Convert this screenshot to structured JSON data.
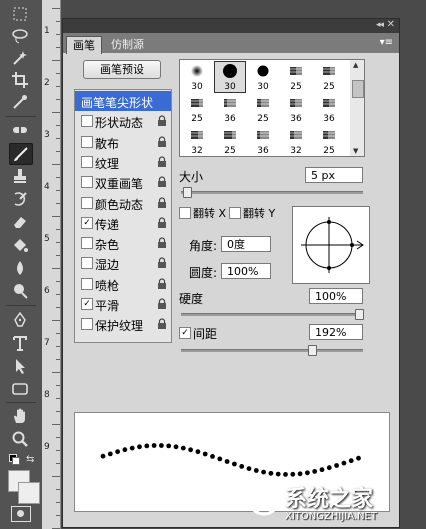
{
  "ruler": {
    "numbers": [
      "1",
      "2",
      "3",
      "4",
      "5",
      "6",
      "7",
      "8",
      "9"
    ]
  },
  "panel": {
    "collapse_glyph": "◂◂",
    "close_glyph": "✕",
    "menu_glyph": "▾≡",
    "tabs": [
      {
        "label": "画笔",
        "active": true
      },
      {
        "label": "仿制源",
        "active": false
      }
    ]
  },
  "brush": {
    "presets_button": "画笔预设",
    "options": [
      {
        "label": "画笔笔尖形状",
        "checked": null,
        "selected": true,
        "locked": false
      },
      {
        "label": "形状动态",
        "checked": false,
        "selected": false,
        "locked": true
      },
      {
        "label": "散布",
        "checked": false,
        "selected": false,
        "locked": true
      },
      {
        "label": "纹理",
        "checked": false,
        "selected": false,
        "locked": true
      },
      {
        "label": "双重画笔",
        "checked": false,
        "selected": false,
        "locked": true
      },
      {
        "label": "颜色动态",
        "checked": false,
        "selected": false,
        "locked": true
      },
      {
        "label": "传递",
        "checked": true,
        "selected": false,
        "locked": true
      },
      {
        "label": "杂色",
        "checked": false,
        "selected": false,
        "locked": true
      },
      {
        "label": "湿边",
        "checked": false,
        "selected": false,
        "locked": true
      },
      {
        "label": "喷枪",
        "checked": false,
        "selected": false,
        "locked": true
      },
      {
        "label": "平滑",
        "checked": true,
        "selected": false,
        "locked": true
      },
      {
        "label": "保护纹理",
        "checked": false,
        "selected": false,
        "locked": true
      }
    ],
    "tips": [
      {
        "size": "30",
        "kind": "soft-round",
        "selected": false
      },
      {
        "size": "30",
        "kind": "hard-round-lg",
        "selected": true
      },
      {
        "size": "30",
        "kind": "hard-round",
        "selected": false
      },
      {
        "size": "25",
        "kind": "flat-bristle",
        "selected": false
      },
      {
        "size": "25",
        "kind": "flat-fan",
        "selected": false
      },
      {
        "size": "25",
        "kind": "flat-angle",
        "selected": false
      },
      {
        "size": "36",
        "kind": "round-bristle",
        "selected": false
      },
      {
        "size": "25",
        "kind": "round-fan",
        "selected": false
      },
      {
        "size": "36",
        "kind": "fan",
        "selected": false
      },
      {
        "size": "36",
        "kind": "angle",
        "selected": false
      },
      {
        "size": "32",
        "kind": "chalk",
        "selected": false
      },
      {
        "size": "25",
        "kind": "blunt",
        "selected": false
      },
      {
        "size": "36",
        "kind": "round-flat",
        "selected": false
      },
      {
        "size": "32",
        "kind": "brush-b",
        "selected": false
      },
      {
        "size": "25",
        "kind": "fan-sm",
        "selected": false
      },
      {
        "size": "14",
        "kind": "star",
        "selected": false
      },
      {
        "size": "24",
        "kind": "spatter",
        "selected": false
      }
    ],
    "size_label": "大小",
    "size_value": "5 px",
    "size_fraction": 0.01,
    "flip_x_label": "翻转 X",
    "flip_y_label": "翻转 Y",
    "flip_x": false,
    "flip_y": false,
    "angle_label": "角度:",
    "angle_value": "0度",
    "roundness_label": "圆度:",
    "roundness_value": "100%",
    "hardness_label": "硬度",
    "hardness_value": "100%",
    "hardness_fraction": 1.0,
    "spacing_label": "间距",
    "spacing_checked": true,
    "spacing_value": "192%",
    "spacing_fraction": 0.73
  },
  "watermark": {
    "text": "系统之家",
    "url": "XITONGZHIJIA.NET"
  },
  "colors": {
    "accent": "#3a6ad4",
    "panel_bg": "#d6d6d6",
    "toolbar_bg": "#535353"
  }
}
